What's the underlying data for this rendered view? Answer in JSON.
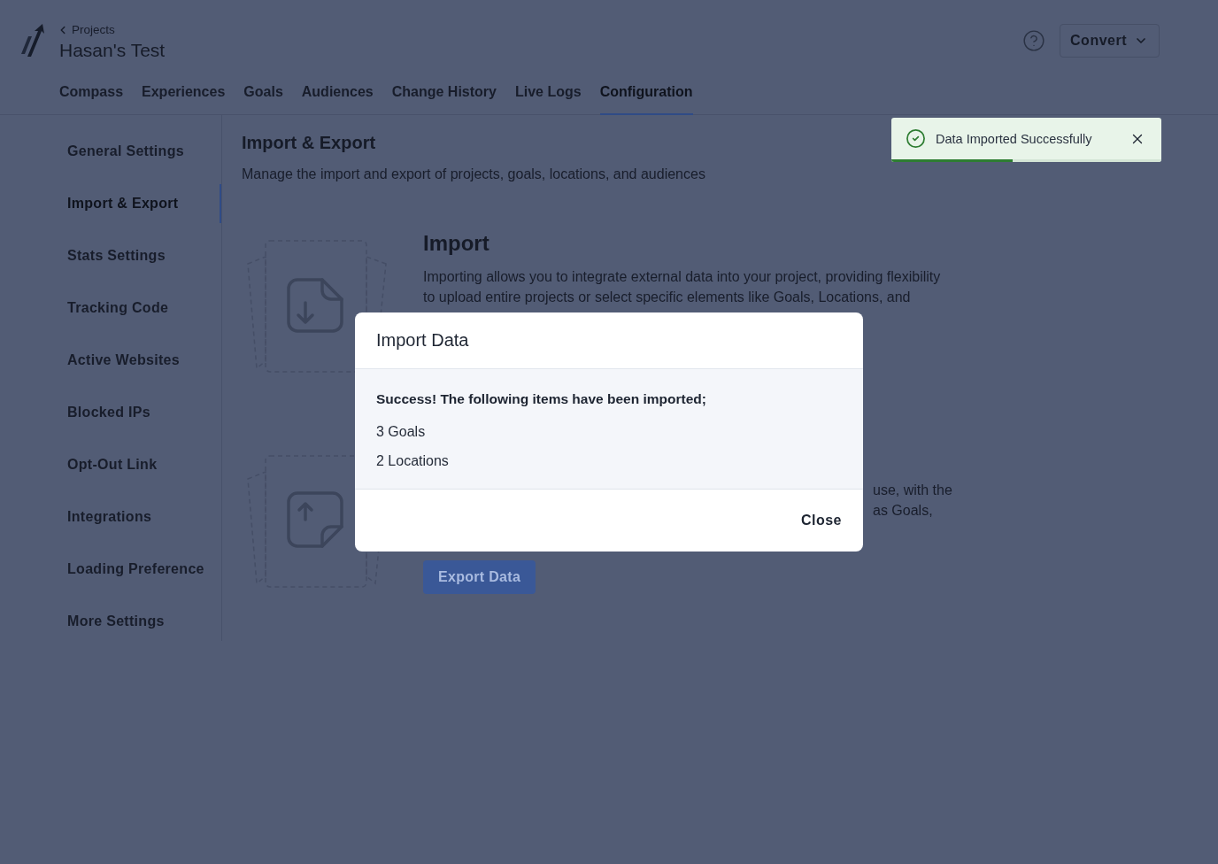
{
  "header": {
    "back_link": "Projects",
    "project_name": "Hasan's Test",
    "account_menu": {
      "label": "Convert"
    }
  },
  "tabs": [
    {
      "label": "Compass",
      "selected": false
    },
    {
      "label": "Experiences",
      "selected": false
    },
    {
      "label": "Goals",
      "selected": false
    },
    {
      "label": "Audiences",
      "selected": false
    },
    {
      "label": "Change History",
      "selected": false
    },
    {
      "label": "Live Logs",
      "selected": false
    },
    {
      "label": "Configuration",
      "selected": true
    }
  ],
  "sidebar": {
    "items": [
      {
        "label": "General Settings",
        "selected": false
      },
      {
        "label": "Import & Export",
        "selected": true
      },
      {
        "label": "Stats Settings",
        "selected": false
      },
      {
        "label": "Tracking Code",
        "selected": false
      },
      {
        "label": "Active Websites",
        "selected": false
      },
      {
        "label": "Blocked IPs",
        "selected": false
      },
      {
        "label": "Opt-Out Link",
        "selected": false
      },
      {
        "label": "Integrations",
        "selected": false
      },
      {
        "label": "Loading Preference",
        "selected": false
      },
      {
        "label": "More Settings",
        "selected": false
      }
    ]
  },
  "page": {
    "title": "Import & Export",
    "subtitle": "Manage the import and export of projects, goals, locations, and audiences"
  },
  "sections": [
    {
      "kind": "import",
      "heading": "Import",
      "description": "Importing allows you to integrate external data into your project, providing flexibility to upload entire projects or select specific elements like Goals, Locations, and"
    },
    {
      "kind": "export",
      "description_lines": [
        "use, with the",
        "as Goals,"
      ],
      "button": "Export Data"
    }
  ],
  "modal": {
    "title": "Import Data",
    "message": "Success! The following items have been imported;",
    "items": [
      "3 Goals",
      "2 Locations"
    ],
    "close_button": "Close"
  },
  "toast": {
    "message": "Data Imported Successfully",
    "progress": {
      "level": 0.45
    }
  }
}
